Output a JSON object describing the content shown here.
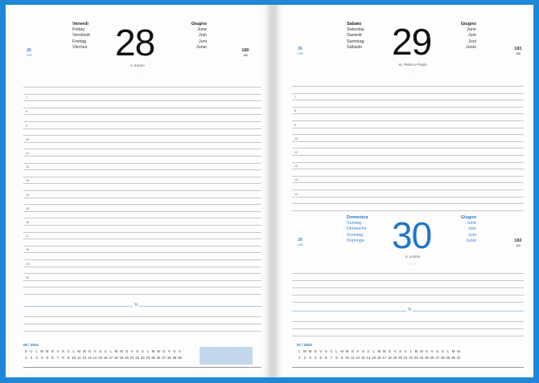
{
  "left": {
    "week": "26",
    "week_small": "V.96",
    "day_num": "28",
    "day_names": [
      "Venerdì",
      "Friday",
      "Vendredi",
      "Freitag",
      "Viernes"
    ],
    "months": [
      "Giugno",
      "June",
      "Juin",
      "Juni",
      "Junio"
    ],
    "day_of_year": "180",
    "days_left": "186",
    "saint": "s. Ireneo",
    "moon": "◦",
    "hours": [
      "7",
      "8",
      "9",
      "10",
      "11",
      "12",
      "13",
      "14",
      "15",
      "16",
      "17",
      "18",
      "19",
      "20"
    ],
    "separator_mark": "%",
    "calendar_title": "06 / 2024",
    "calendar_days": [
      "S",
      "D",
      "L",
      "M",
      "M",
      "G",
      "V",
      "S",
      "D",
      "L",
      "M",
      "M",
      "G",
      "V",
      "S",
      "D",
      "L",
      "M",
      "M",
      "G",
      "V",
      "S",
      "D",
      "L",
      "M",
      "M",
      "G",
      "V",
      "S",
      "D"
    ],
    "calendar_dates": [
      "1",
      "2",
      "3",
      "4",
      "5",
      "6",
      "7",
      "8",
      "9",
      "10",
      "11",
      "12",
      "13",
      "14",
      "15",
      "16",
      "17",
      "18",
      "19",
      "20",
      "21",
      "22",
      "23",
      "24",
      "25",
      "26",
      "27",
      "28",
      "29",
      "30"
    ]
  },
  "right": {
    "week": "26",
    "week_small": "V.96",
    "day_num": "29",
    "day_names": [
      "Sabato",
      "Saturday",
      "Samedi",
      "Samstag",
      "Sábado"
    ],
    "months": [
      "Giugno",
      "June",
      "Juin",
      "Juni",
      "Junio"
    ],
    "day_of_year": "181",
    "days_left": "185",
    "saint": "ss. Pietro e Paolo",
    "moon": "◦ ◦",
    "hours": [
      "7",
      "8",
      "9",
      "10",
      "11",
      "12",
      "13",
      "14"
    ],
    "sunday": {
      "week": "26",
      "week_small": "V.96",
      "day_num": "30",
      "day_names": [
        "Domenica",
        "Sunday",
        "Dimanche",
        "Sonntag",
        "Domingo"
      ],
      "months": [
        "Giugno",
        "June",
        "Juin",
        "Juni",
        "Junio"
      ],
      "day_of_year": "182",
      "days_left": "184",
      "saint": "s. Lucina",
      "moon": "◦◦ ◦ ◦◦"
    },
    "separator_mark": "%",
    "calendar_title": "07 / 2024",
    "calendar_days": [
      "L",
      "M",
      "M",
      "G",
      "V",
      "S",
      "D",
      "L",
      "M",
      "M",
      "G",
      "V",
      "S",
      "D",
      "L",
      "M",
      "M",
      "G",
      "V",
      "S",
      "D",
      "L",
      "M",
      "M",
      "G",
      "V",
      "S",
      "D",
      "L",
      "M",
      "M"
    ],
    "calendar_dates": [
      "1",
      "2",
      "3",
      "4",
      "5",
      "6",
      "7",
      "8",
      "9",
      "10",
      "11",
      "12",
      "13",
      "14",
      "15",
      "16",
      "17",
      "18",
      "19",
      "20",
      "21",
      "22",
      "23",
      "24",
      "25",
      "26",
      "27",
      "28",
      "29",
      "30",
      "31"
    ]
  },
  "colors": {
    "accent": "#1f77c7",
    "frame": "#1e88d6"
  }
}
